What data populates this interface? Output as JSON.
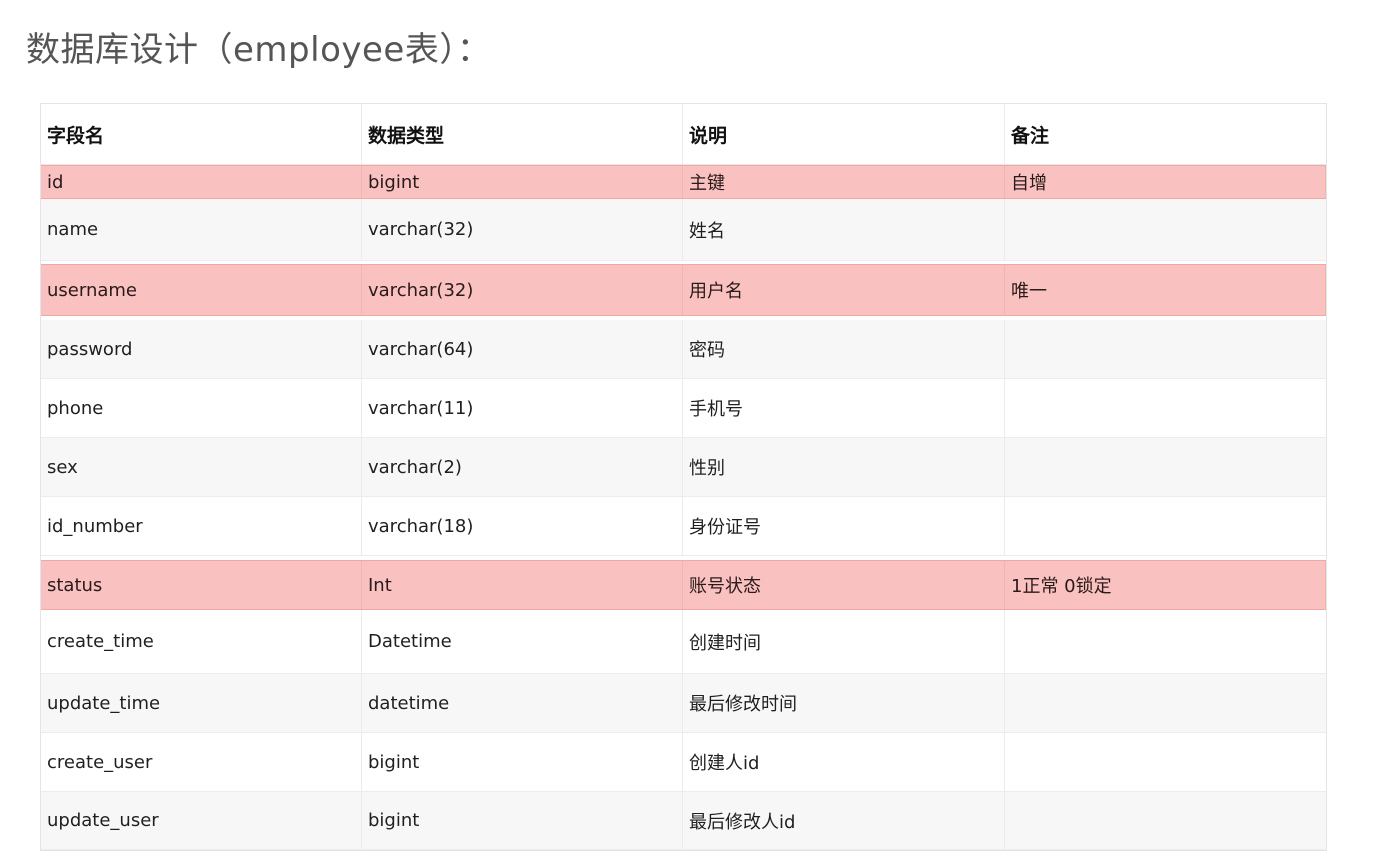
{
  "title": "数据库设计（employee表）：",
  "table": {
    "headers": [
      "字段名",
      "数据类型",
      "说明",
      "备注"
    ],
    "rows": [
      {
        "field": "id",
        "type": "bigint",
        "desc": "主键",
        "note": "自增",
        "highlight": true
      },
      {
        "field": "name",
        "type": "varchar(32)",
        "desc": "姓名",
        "note": "",
        "highlight": false
      },
      {
        "field": "username",
        "type": "varchar(32)",
        "desc": "用户名",
        "note": "唯一",
        "highlight": true
      },
      {
        "field": "password",
        "type": "varchar(64)",
        "desc": "密码",
        "note": "",
        "highlight": false
      },
      {
        "field": "phone",
        "type": "varchar(11)",
        "desc": "手机号",
        "note": "",
        "highlight": false
      },
      {
        "field": "sex",
        "type": "varchar(2)",
        "desc": "性别",
        "note": "",
        "highlight": false
      },
      {
        "field": "id_number",
        "type": "varchar(18)",
        "desc": "身份证号",
        "note": "",
        "highlight": false
      },
      {
        "field": "status",
        "type": "Int",
        "desc": "账号状态",
        "note": "1正常 0锁定",
        "highlight": true
      },
      {
        "field": "create_time",
        "type": "Datetime",
        "desc": "创建时间",
        "note": "",
        "highlight": false
      },
      {
        "field": "update_time",
        "type": "datetime",
        "desc": "最后修改时间",
        "note": "",
        "highlight": false
      },
      {
        "field": "create_user",
        "type": "bigint",
        "desc": "创建人id",
        "note": "",
        "highlight": false
      },
      {
        "field": "update_user",
        "type": "bigint",
        "desc": "最后修改人id",
        "note": "",
        "highlight": false
      }
    ]
  },
  "colors": {
    "highlight_row": "#f9c1bf",
    "alt_row": "#f7f7f7",
    "title_text": "#555555"
  }
}
